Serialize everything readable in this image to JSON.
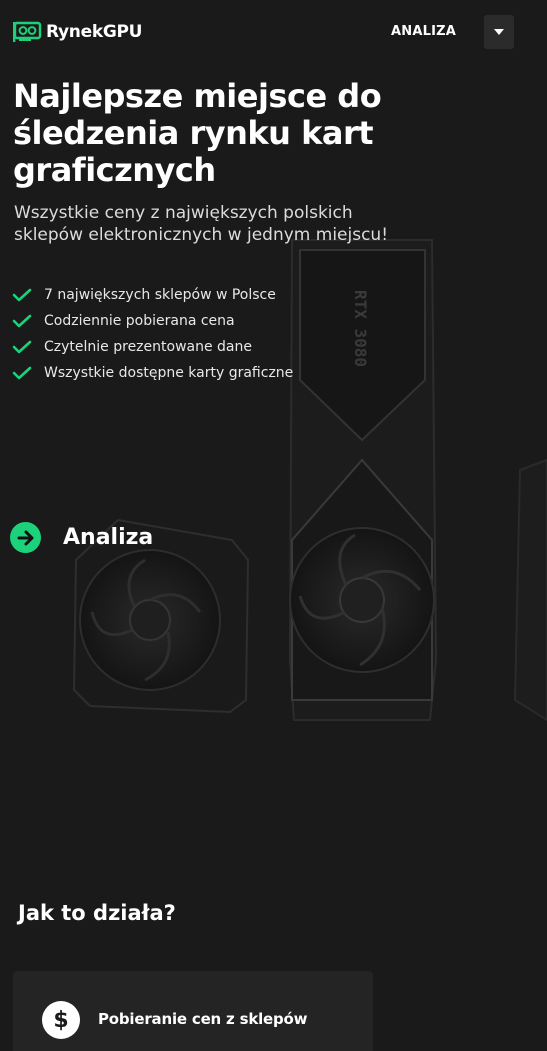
{
  "header": {
    "brand": "RynekGPU",
    "nav_label": "ANALIZA"
  },
  "hero": {
    "title": "Najlepsze miejsce do śledzenia rynku kart graficznych",
    "subtitle": "Wszystkie ceny z największych polskich sklepów elektronicznych w jednym miejscu!",
    "features": [
      "7 największych sklepów w Polsce",
      "Codziennie pobierana cena",
      "Czytelnie prezentowane dane",
      "Wszystkie dostępne karty graficzne"
    ],
    "cta_label": "Analiza",
    "gpu_marking": "RTX 3080"
  },
  "how": {
    "title": "Jak to działa?",
    "cards": [
      {
        "icon": "dollar-icon",
        "title": "Pobieranie cen z sklepów"
      }
    ]
  },
  "colors": {
    "background": "#1a1a1a",
    "accent": "#1bd27b",
    "card": "#242424"
  }
}
